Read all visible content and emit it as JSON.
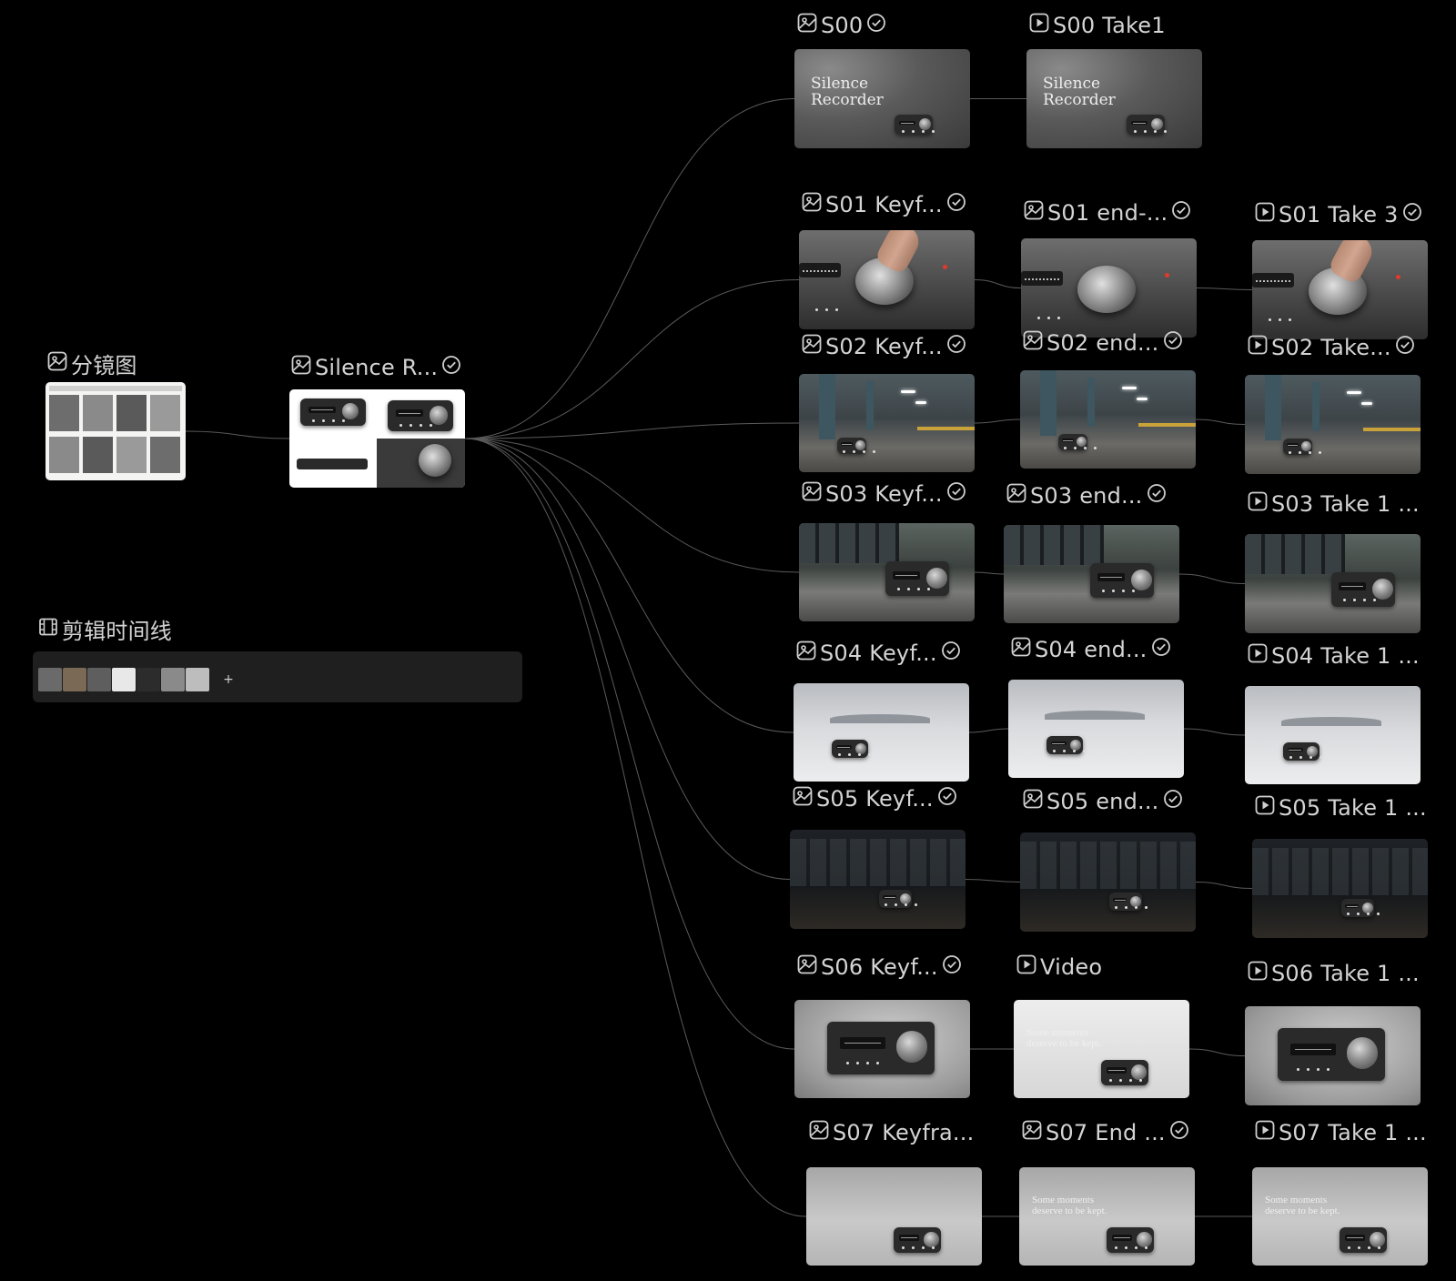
{
  "canvas": {
    "background": "#000000",
    "wire_color": "#5a5a5a",
    "nodes": {
      "storyboard": {
        "label": "分镜图",
        "icon": "image-icon"
      },
      "product_ref": {
        "label": "Silence R...",
        "icon": "image-icon",
        "done": true
      },
      "timeline": {
        "label": "剪辑时间线",
        "icon": "film-strip-icon",
        "add_label": "+"
      },
      "s00": {
        "label": "S00",
        "icon": "image-icon",
        "done": true,
        "title_line1": "Silence",
        "title_line2": "Recorder"
      },
      "s00_take1": {
        "label": "S00 Take1",
        "icon": "video-icon",
        "title_line1": "Silence",
        "title_line2": "Recorder"
      },
      "s01_key": {
        "label": "S01 Keyf...",
        "icon": "image-icon",
        "done": true
      },
      "s01_end": {
        "label": "S01 end-...",
        "icon": "image-icon",
        "done": true
      },
      "s01_take": {
        "label": "S01 Take 3",
        "icon": "video-icon",
        "done": true
      },
      "s02_key": {
        "label": "S02 Keyf...",
        "icon": "image-icon",
        "done": true
      },
      "s02_end": {
        "label": "S02 end...",
        "icon": "image-icon",
        "done": true
      },
      "s02_take": {
        "label": "S02 Take...",
        "icon": "video-icon",
        "done": true
      },
      "s03_key": {
        "label": "S03 Keyf...",
        "icon": "image-icon",
        "done": true
      },
      "s03_end": {
        "label": "S03 end...",
        "icon": "image-icon",
        "done": true
      },
      "s03_take": {
        "label": "S03 Take 1 ...",
        "icon": "video-icon"
      },
      "s04_key": {
        "label": "S04 Keyf...",
        "icon": "image-icon",
        "done": true
      },
      "s04_end": {
        "label": "S04 end...",
        "icon": "image-icon",
        "done": true
      },
      "s04_take": {
        "label": "S04 Take 1 ...",
        "icon": "video-icon"
      },
      "s05_key": {
        "label": "S05 Keyf...",
        "icon": "image-icon",
        "done": true
      },
      "s05_end": {
        "label": "S05 end...",
        "icon": "image-icon",
        "done": true
      },
      "s05_take": {
        "label": "S05 Take 1 ...",
        "icon": "video-icon"
      },
      "s06_key": {
        "label": "S06 Keyf...",
        "icon": "image-icon",
        "done": true
      },
      "s06_video": {
        "label": "Video",
        "icon": "video-icon",
        "caption_line1": "Some moments",
        "caption_line2": "deserve to be kept."
      },
      "s06_take": {
        "label": "S06 Take 1 ...",
        "icon": "video-icon"
      },
      "s07_key": {
        "label": "S07 Keyfra...",
        "icon": "image-icon"
      },
      "s07_end": {
        "label": "S07 End ...",
        "icon": "image-icon",
        "done": true,
        "caption_line1": "Some moments",
        "caption_line2": "deserve to be kept."
      },
      "s07_take": {
        "label": "S07 Take 1 ...",
        "icon": "video-icon",
        "caption_line1": "Some moments",
        "caption_line2": "deserve to be kept."
      }
    }
  }
}
